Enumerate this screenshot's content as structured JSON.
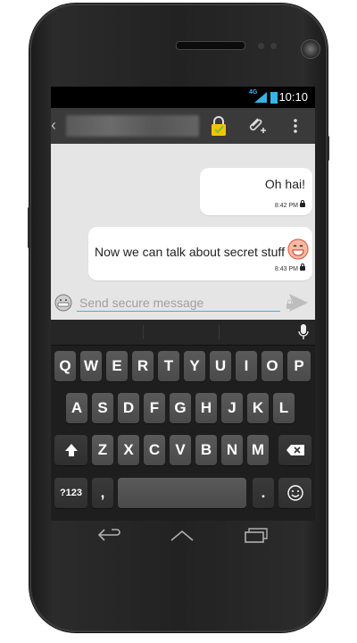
{
  "status_bar": {
    "network": "4G",
    "time": "10:10"
  },
  "action_bar": {
    "back_glyph": "‹",
    "icons": [
      "lock-check-icon",
      "attach-icon",
      "overflow-menu-icon"
    ]
  },
  "messages": [
    {
      "text": "Oh hai!",
      "time": "8:42 PM",
      "icon": "lock-icon"
    },
    {
      "text": "Now we can talk about secret stuff",
      "time": "8:43 PM",
      "icon": "lock-icon",
      "emoji": "grinning-emoji-icon"
    }
  ],
  "composer": {
    "placeholder": "Send secure message"
  },
  "keyboard": {
    "row1": [
      "Q",
      "W",
      "E",
      "R",
      "T",
      "Y",
      "U",
      "I",
      "O",
      "P"
    ],
    "row2": [
      "A",
      "S",
      "D",
      "F",
      "G",
      "H",
      "J",
      "K",
      "L"
    ],
    "row3": [
      "Z",
      "X",
      "C",
      "V",
      "B",
      "N",
      "M"
    ],
    "numbers_key": "?123",
    "comma_key": ",",
    "period_key": "."
  },
  "colors": {
    "accent": "#33b5e5",
    "chat_bg": "#e5e5e5",
    "action_bar": "#3a3a3a",
    "lock_yellow": "#f2c500",
    "check_green": "#7dc242"
  }
}
